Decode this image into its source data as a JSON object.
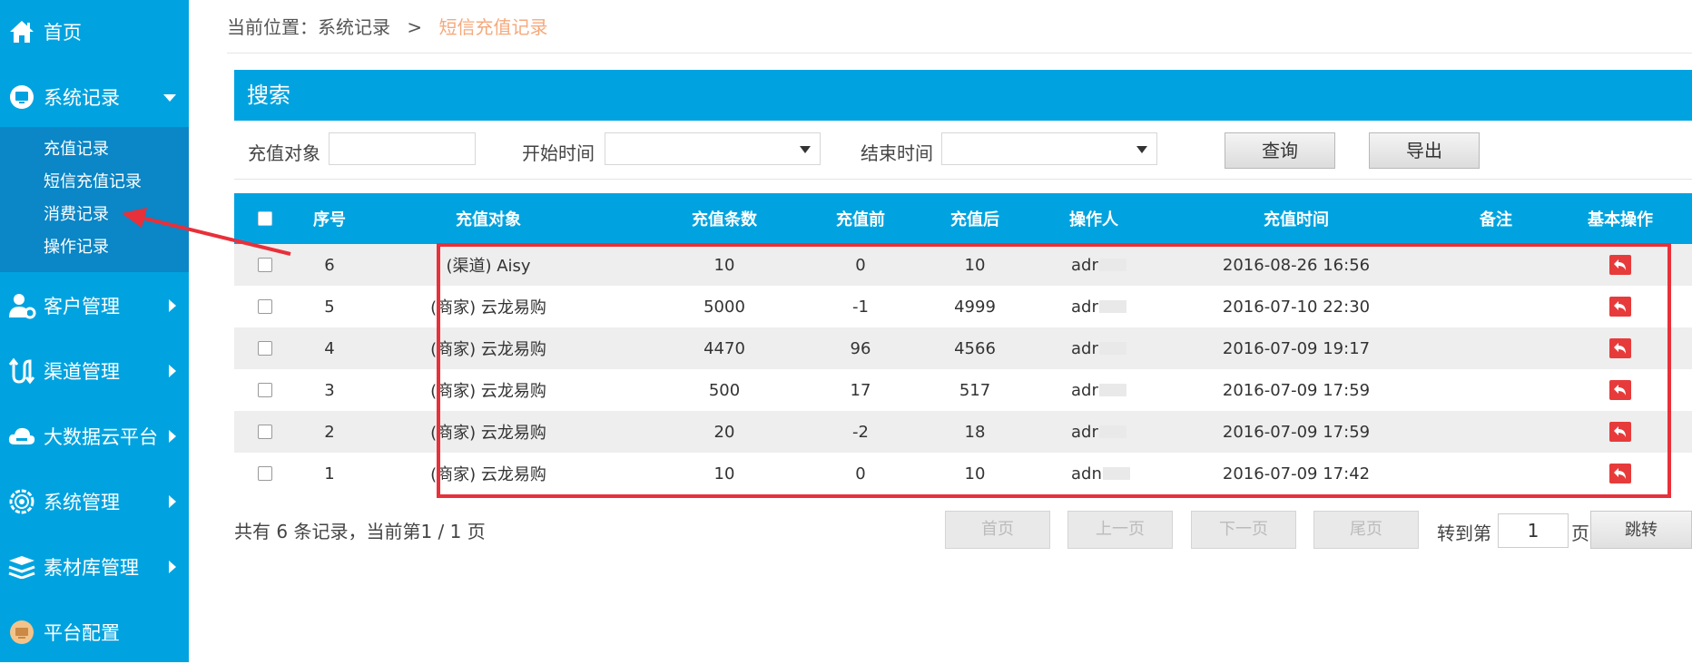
{
  "sidebar": {
    "items": [
      {
        "label": "首页",
        "icon": "home-icon"
      },
      {
        "label": "系统记录",
        "icon": "monitor-icon"
      },
      {
        "label": "客户管理",
        "icon": "user-gear-icon"
      },
      {
        "label": "渠道管理",
        "icon": "channel-icon"
      },
      {
        "label": "大数据云平台",
        "icon": "cloud-icon"
      },
      {
        "label": "系统管理",
        "icon": "gear-icon"
      },
      {
        "label": "素材库管理",
        "icon": "stack-icon"
      },
      {
        "label": "平台配置",
        "icon": "platform-icon"
      }
    ],
    "sub_items": [
      "充值记录",
      "短信充值记录",
      "消费记录",
      "操作记录"
    ]
  },
  "breadcrumb": {
    "prefix": "当前位置：系统记录",
    "separator": ">",
    "current": "短信充值记录"
  },
  "search": {
    "title": "搜索",
    "target_label": "充值对象",
    "target_value": "",
    "start_label": "开始时间",
    "end_label": "结束时间",
    "query_button": "查询",
    "export_button": "导出"
  },
  "table": {
    "headers": [
      "序号",
      "充值对象",
      "充值条数",
      "充值前",
      "充值后",
      "操作人",
      "充值时间",
      "备注",
      "基本操作"
    ],
    "rows": [
      {
        "seq": "6",
        "target": "(渠道) Aisy",
        "count": "10",
        "before": "0",
        "after": "10",
        "operator": "adr",
        "time": "2016-08-26 16:56",
        "remark": ""
      },
      {
        "seq": "5",
        "target": "(商家) 云龙易购",
        "count": "5000",
        "before": "-1",
        "after": "4999",
        "operator": "adr",
        "time": "2016-07-10 22:30",
        "remark": ""
      },
      {
        "seq": "4",
        "target": "(商家) 云龙易购",
        "count": "4470",
        "before": "96",
        "after": "4566",
        "operator": "adr",
        "time": "2016-07-09 19:17",
        "remark": ""
      },
      {
        "seq": "3",
        "target": "(商家) 云龙易购",
        "count": "500",
        "before": "17",
        "after": "517",
        "operator": "adr",
        "time": "2016-07-09 17:59",
        "remark": ""
      },
      {
        "seq": "2",
        "target": "(商家) 云龙易购",
        "count": "20",
        "before": "-2",
        "after": "18",
        "operator": "adr",
        "time": "2016-07-09 17:59",
        "remark": ""
      },
      {
        "seq": "1",
        "target": "(商家) 云龙易购",
        "count": "10",
        "before": "0",
        "after": "10",
        "operator": "adn",
        "time": "2016-07-09 17:42",
        "remark": ""
      }
    ]
  },
  "pager": {
    "summary": "共有 6 条记录，当前第1 / 1 页",
    "first": "首页",
    "prev": "上一页",
    "next": "下一页",
    "last": "尾页",
    "goto_label": "转到第",
    "page_value": "1",
    "page_suffix": "页",
    "jump": "跳转"
  },
  "colors": {
    "primary": "#00a3e0",
    "sidebar_sub": "#0b86c6",
    "highlight": "#e8303a",
    "breadcrumb_current": "#f5a97c",
    "action_red": "#e73b3b"
  }
}
